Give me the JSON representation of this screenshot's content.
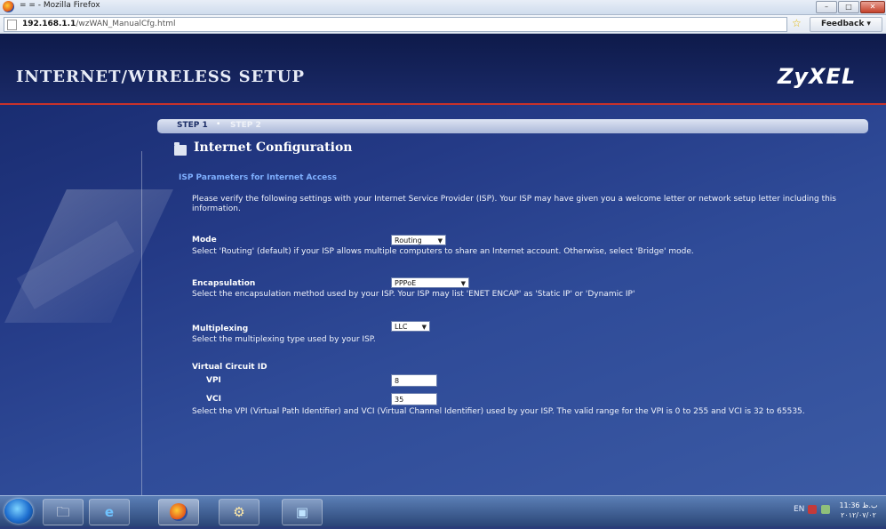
{
  "window": {
    "title": "= = - Mozilla Firefox",
    "minimize": "–",
    "maximize": "□",
    "close": "✕"
  },
  "addressbar": {
    "url_host": "192.168.1.1",
    "url_path": "/wzWAN_ManualCfg.html",
    "feedback_label": "Feedback ▾"
  },
  "header": {
    "title": "INTERNET/WIRELESS SETUP",
    "logo": "ZyXEL"
  },
  "steps": {
    "step1": "STEP 1",
    "separator": "•",
    "step2": "STEP 2"
  },
  "section": {
    "title": "Internet Configuration",
    "isp_heading": "ISP Parameters for Internet Access",
    "intro": "Please verify the following settings with your Internet Service Provider (ISP). Your ISP may have given you a welcome letter or network setup letter including this information."
  },
  "mode": {
    "label": "Mode",
    "value": "Routing",
    "description": "Select 'Routing' (default) if your ISP allows multiple computers to share an Internet account. Otherwise, select 'Bridge' mode."
  },
  "encapsulation": {
    "label": "Encapsulation",
    "value": "PPPoE",
    "description": "Select the encapsulation method used by your ISP. Your ISP may list 'ENET ENCAP' as 'Static IP' or 'Dynamic IP'"
  },
  "multiplexing": {
    "label": "Multiplexing",
    "value": "LLC",
    "description": "Select the multiplexing type used by your ISP."
  },
  "vc": {
    "label": "Virtual Circuit ID",
    "vpi_label": "VPI",
    "vpi_value": "8",
    "vci_label": "VCI",
    "vci_value": "35",
    "description": "Select the VPI (Virtual Path Identifier) and VCI (Virtual Channel Identifier) used by your ISP. The valid range for the VPI is 0 to 255 and VCI is 32 to 65535."
  },
  "taskbar": {
    "language": "EN",
    "time": "11:36 ب.ظ",
    "date": "۲۰۱۲/۰۷/۰۲"
  },
  "icons": {
    "start": "windows-start-icon",
    "explorer": "folder-icon",
    "ie": "internet-explorer-icon",
    "firefox": "firefox-icon",
    "app4": "network-tool-icon",
    "app5": "desktop-app-icon"
  }
}
